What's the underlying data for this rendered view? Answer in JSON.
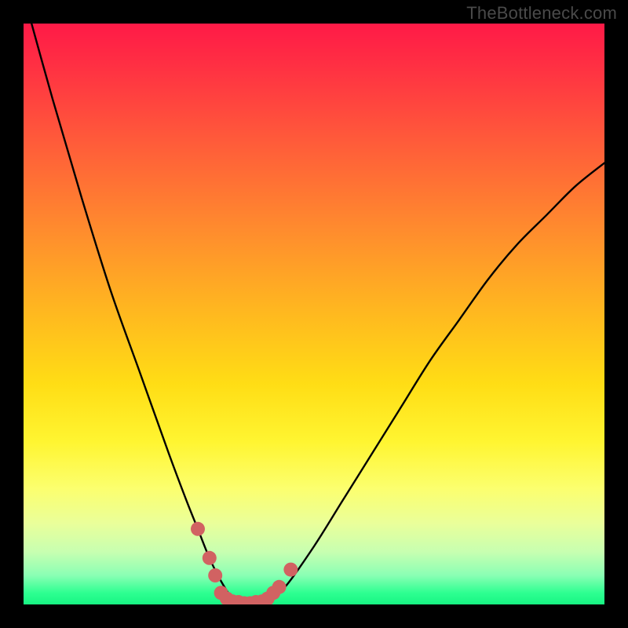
{
  "watermark": "TheBottleneck.com",
  "colors": {
    "gradient_top": "#ff1a47",
    "gradient_mid": "#ffdd15",
    "gradient_bottom": "#17f583",
    "curve": "#000000",
    "marker": "#d16262",
    "frame": "#000000"
  },
  "chart_data": {
    "type": "line",
    "title": "",
    "xlabel": "",
    "ylabel": "",
    "xlim": [
      0,
      100
    ],
    "ylim": [
      0,
      100
    ],
    "grid": false,
    "series": [
      {
        "name": "bottleneck-curve",
        "x": [
          0,
          5,
          10,
          15,
          20,
          25,
          28,
          30,
          32,
          34,
          36,
          38,
          40,
          42,
          45,
          50,
          55,
          60,
          65,
          70,
          75,
          80,
          85,
          90,
          95,
          100
        ],
        "y": [
          105,
          87,
          70,
          54,
          40,
          26,
          18,
          13,
          8,
          4,
          1,
          0,
          0,
          1,
          3,
          10,
          18,
          26,
          34,
          42,
          49,
          56,
          62,
          67,
          72,
          76
        ]
      }
    ],
    "annotations": [
      {
        "name": "trough-markers",
        "shape": "circle",
        "color": "#d16262",
        "x": [
          30,
          32,
          33,
          34,
          35,
          36,
          37,
          38,
          39,
          40,
          41,
          42,
          43,
          44,
          46
        ],
        "y": [
          13,
          8,
          5,
          2,
          1,
          0.5,
          0.4,
          0.2,
          0.2,
          0.4,
          0.5,
          1,
          2,
          3,
          6
        ]
      }
    ]
  }
}
